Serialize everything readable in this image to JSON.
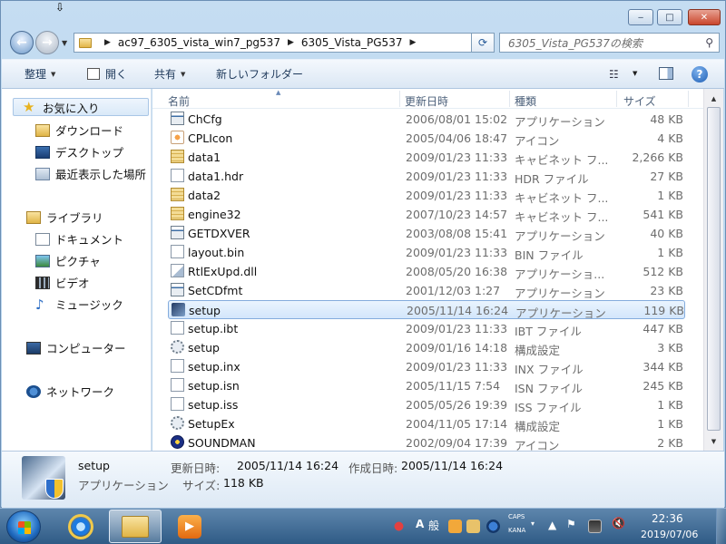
{
  "window": {
    "caption": {
      "minimize": "‒",
      "maximize": "□",
      "close": "✕"
    }
  },
  "nav": {
    "back_glyph": "←",
    "forward_glyph": "→",
    "breadcrumb": [
      "ac97_6305_vista_win7_pg537",
      "6305_Vista_PG537"
    ],
    "search_placeholder": "6305_Vista_PG537の検索"
  },
  "toolbar": {
    "organize": "整理",
    "open": "開く",
    "share": "共有",
    "new_folder": "新しいフォルダー",
    "help": "?"
  },
  "navpane": {
    "favorites": "お気に入り",
    "fav_items": [
      "ダウンロード",
      "デスクトップ",
      "最近表示した場所"
    ],
    "libraries": "ライブラリ",
    "lib_items": [
      "ドキュメント",
      "ピクチャ",
      "ビデオ",
      "ミュージック"
    ],
    "computer": "コンピューター",
    "network": "ネットワーク"
  },
  "columns": {
    "name": "名前",
    "date": "更新日時",
    "type": "種類",
    "size": "サイズ"
  },
  "files": [
    {
      "name": "ChCfg",
      "date": "2006/08/01 15:02",
      "type": "アプリケーション",
      "size": "48 KB",
      "icon": "application-icon"
    },
    {
      "name": "CPLIcon",
      "date": "2005/04/06 18:47",
      "type": "アイコン",
      "size": "4 KB",
      "icon": "speaker-icon"
    },
    {
      "name": "data1",
      "date": "2009/01/23 11:33",
      "type": "キャビネット フ...",
      "size": "2,266 KB",
      "icon": "cabinet-icon"
    },
    {
      "name": "data1.hdr",
      "date": "2009/01/23 11:33",
      "type": "HDR ファイル",
      "size": "27 KB",
      "icon": "document-icon"
    },
    {
      "name": "data2",
      "date": "2009/01/23 11:33",
      "type": "キャビネット フ...",
      "size": "1 KB",
      "icon": "cabinet-icon"
    },
    {
      "name": "engine32",
      "date": "2007/10/23 14:57",
      "type": "キャビネット フ...",
      "size": "541 KB",
      "icon": "cabinet-icon"
    },
    {
      "name": "GETDXVER",
      "date": "2003/08/08 15:41",
      "type": "アプリケーション",
      "size": "40 KB",
      "icon": "application-icon"
    },
    {
      "name": "layout.bin",
      "date": "2009/01/23 11:33",
      "type": "BIN ファイル",
      "size": "1 KB",
      "icon": "document-icon"
    },
    {
      "name": "RtlExUpd.dll",
      "date": "2008/05/20 16:38",
      "type": "アプリケーショ...",
      "size": "512 KB",
      "icon": "dll-icon"
    },
    {
      "name": "SetCDfmt",
      "date": "2001/12/03 1:27",
      "type": "アプリケーション",
      "size": "23 KB",
      "icon": "application-icon"
    },
    {
      "name": "setup",
      "date": "2005/11/14 16:24",
      "type": "アプリケーション",
      "size": "119 KB",
      "icon": "setup-icon",
      "selected": true
    },
    {
      "name": "setup.ibt",
      "date": "2009/01/23 11:33",
      "type": "IBT ファイル",
      "size": "447 KB",
      "icon": "document-icon"
    },
    {
      "name": "setup",
      "date": "2009/01/16 14:18",
      "type": "構成設定",
      "size": "3 KB",
      "icon": "config-icon"
    },
    {
      "name": "setup.inx",
      "date": "2009/01/23 11:33",
      "type": "INX ファイル",
      "size": "344 KB",
      "icon": "document-icon"
    },
    {
      "name": "setup.isn",
      "date": "2005/11/15 7:54",
      "type": "ISN ファイル",
      "size": "245 KB",
      "icon": "document-icon"
    },
    {
      "name": "setup.iss",
      "date": "2005/05/26 19:39",
      "type": "ISS ファイル",
      "size": "1 KB",
      "icon": "document-icon"
    },
    {
      "name": "SetupEx",
      "date": "2004/11/05 17:14",
      "type": "構成設定",
      "size": "1 KB",
      "icon": "config-icon"
    },
    {
      "name": "SOUNDMAN",
      "date": "2002/09/04 17:39",
      "type": "アイコン",
      "size": "2 KB",
      "icon": "soundman-icon"
    }
  ],
  "details": {
    "name": "setup",
    "type": "アプリケーション",
    "modified_label": "更新日時:",
    "modified_value": "2005/11/14 16:24",
    "created_label": "作成日時:",
    "created_value": "2005/11/14 16:24",
    "size_label": "サイズ:",
    "size_value": "118 KB"
  },
  "taskbar": {
    "ime_mode": "A",
    "ime_kanji": "般",
    "caps": "CAPS",
    "kana": "KANA",
    "time": "22:36",
    "date": "2019/07/06"
  },
  "colors": {
    "accent": "#3d6ea5",
    "selection": "#d3e6fb",
    "taskbar": "#2f5b86"
  }
}
